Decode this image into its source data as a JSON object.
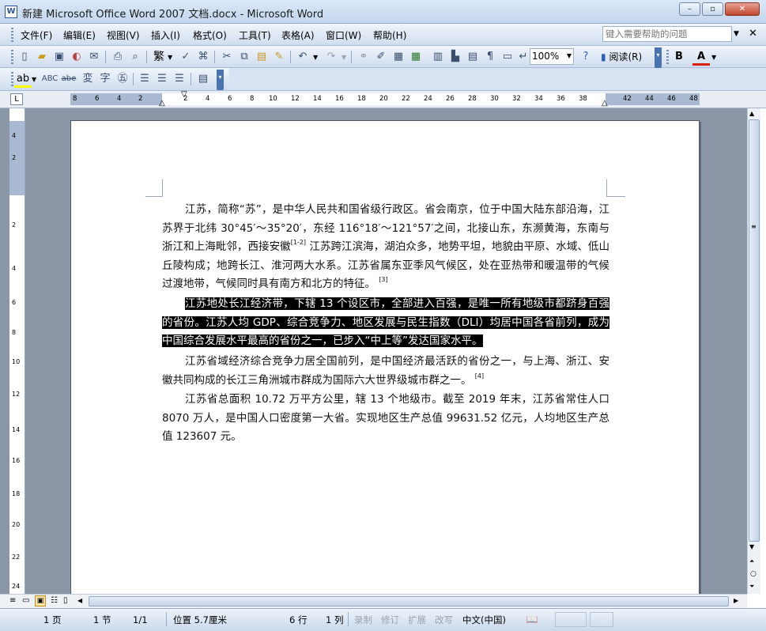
{
  "app": {
    "title": "新建 Microsoft Office Word 2007 文档.docx - Microsoft Word",
    "minimize": "–",
    "maximize": "▫",
    "close": "✕"
  },
  "menu": {
    "items": [
      "文件(F)",
      "编辑(E)",
      "视图(V)",
      "插入(I)",
      "格式(O)",
      "工具(T)",
      "表格(A)",
      "窗口(W)",
      "帮助(H)"
    ],
    "help_placeholder": "键入需要帮助的问题"
  },
  "toolbar": {
    "zoom": "100%",
    "read_label": "阅读(R)",
    "fan": "繁",
    "bold": "B",
    "font_color": "A"
  },
  "ruler": {
    "h_ticks": [
      "8",
      "6",
      "4",
      "2",
      "2",
      "4",
      "6",
      "8",
      "10",
      "12",
      "14",
      "16",
      "18",
      "20",
      "22",
      "24",
      "26",
      "28",
      "30",
      "32",
      "34",
      "36",
      "38",
      "42",
      "44",
      "46",
      "48"
    ],
    "v_ticks": [
      "4",
      "2",
      "2",
      "4",
      "6",
      "8",
      "10",
      "12",
      "14",
      "16",
      "18",
      "20",
      "22",
      "24"
    ]
  },
  "document": {
    "paragraphs": [
      {
        "text": "江苏，简称“苏”，是中华人民共和国省级行政区。省会南京，位于中国大陆东部沿海，江苏界于北纬 30°45′～35°20′，东经 116°18′～121°57′之间，北接山东，东濒黄海，东南与浙江和上海毗邻，西接安徽",
        "ref": "[1-2]",
        "tail": " 江苏跨江滨海，湖泊众多，地势平坦，地貌由平原、水域、低山丘陵构成；地跨长江、淮河两大水系。江苏省属东亚季风气候区，处在亚热带和暖温带的气候过渡地带，气候同时具有南方和北方的特征。",
        "ref2": "[3]"
      },
      {
        "text": "江苏地处长江经济带，下辖 13 个设区市，全部进入百强，是唯一所有地级市都跻身百强的省份。江苏人均 GDP、综合竞争力、地区发展与民生指数（DLI）均居中国各省前列，成为中国综合发展水平最高的省份之一，已步入“中上等”发达国家水平。",
        "selected": true
      },
      {
        "text": "江苏省域经济综合竞争力居全国前列，是中国经济最活跃的省份之一，与上海、浙江、安徽共同构成的长江三角洲城市群成为国际六大世界级城市群之一。",
        "ref": "[4]"
      },
      {
        "text": "江苏省总面积 10.72 万平方公里，辖 13 个地级市。截至 2019 年末，江苏省常住人口 8070 万人，是中国人口密度第一大省。实现地区生产总值 99631.52 亿元，人均地区生产总值 123607 元。"
      }
    ]
  },
  "status": {
    "page": "1 页",
    "section": "1 节",
    "pages": "1/1",
    "position": "位置 5.7厘米",
    "line": "6 行",
    "col": "1 列",
    "rec": "录制",
    "trk": "修订",
    "ext": "扩展",
    "ovr": "改写",
    "lang": "中文(中国)"
  }
}
